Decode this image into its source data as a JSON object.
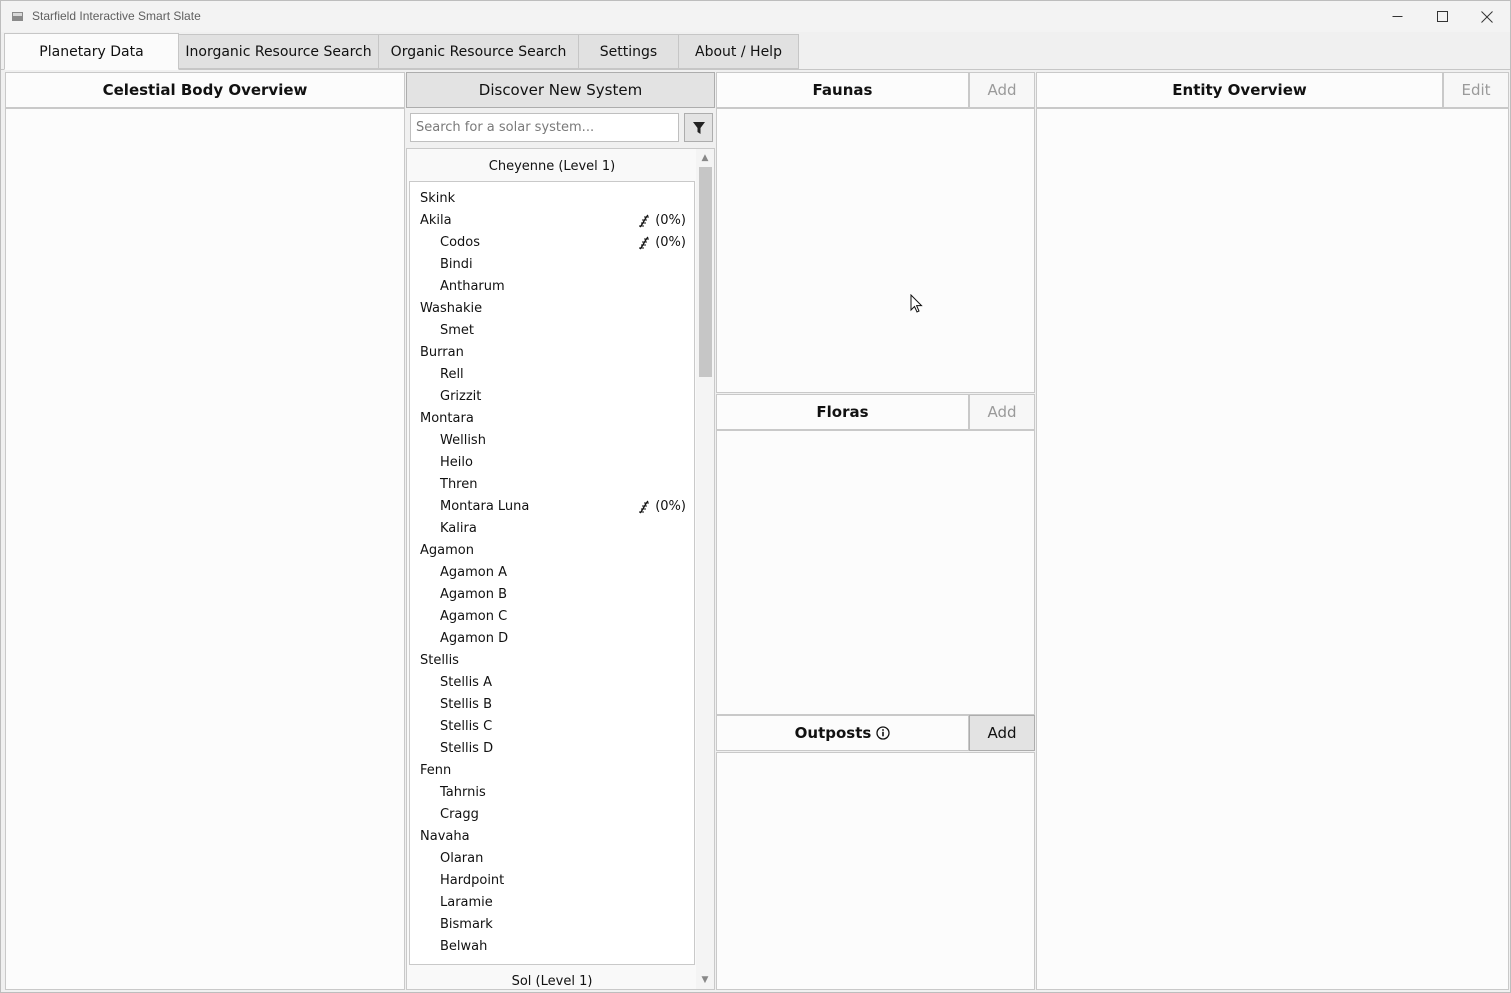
{
  "window": {
    "title": "Starfield Interactive Smart Slate"
  },
  "tabs": [
    {
      "label": "Planetary Data",
      "active": true
    },
    {
      "label": "Inorganic Resource Search"
    },
    {
      "label": "Organic Resource Search"
    },
    {
      "label": "Settings"
    },
    {
      "label": "About / Help"
    }
  ],
  "celestial": {
    "header": "Celestial Body Overview"
  },
  "discover": {
    "button_label": "Discover New System",
    "search_placeholder": "Search for a solar system...",
    "filter_icon": "filter-icon"
  },
  "systems": [
    {
      "title": "Cheyenne (Level 1)",
      "bodies": [
        {
          "name": "Skink",
          "level": 0
        },
        {
          "name": "Akila",
          "level": 0,
          "tag": "(0%)"
        },
        {
          "name": "Codos",
          "level": 1,
          "tag": "(0%)"
        },
        {
          "name": "Bindi",
          "level": 1
        },
        {
          "name": "Antharum",
          "level": 1
        },
        {
          "name": "Washakie",
          "level": 0
        },
        {
          "name": "Smet",
          "level": 1
        },
        {
          "name": "Burran",
          "level": 0
        },
        {
          "name": "Rell",
          "level": 1
        },
        {
          "name": "Grizzit",
          "level": 1
        },
        {
          "name": "Montara",
          "level": 0
        },
        {
          "name": "Wellish",
          "level": 1
        },
        {
          "name": "Heilo",
          "level": 1
        },
        {
          "name": "Thren",
          "level": 1
        },
        {
          "name": "Montara Luna",
          "level": 1,
          "tag": "(0%)"
        },
        {
          "name": "Kalira",
          "level": 1
        },
        {
          "name": "Agamon",
          "level": 0
        },
        {
          "name": "Agamon A",
          "level": 1
        },
        {
          "name": "Agamon B",
          "level": 1
        },
        {
          "name": "Agamon C",
          "level": 1
        },
        {
          "name": "Agamon D",
          "level": 1
        },
        {
          "name": "Stellis",
          "level": 0
        },
        {
          "name": "Stellis A",
          "level": 1
        },
        {
          "name": "Stellis B",
          "level": 1
        },
        {
          "name": "Stellis C",
          "level": 1
        },
        {
          "name": "Stellis D",
          "level": 1
        },
        {
          "name": "Fenn",
          "level": 0
        },
        {
          "name": "Tahrnis",
          "level": 1
        },
        {
          "name": "Cragg",
          "level": 1
        },
        {
          "name": "Navaha",
          "level": 0
        },
        {
          "name": "Olaran",
          "level": 1
        },
        {
          "name": "Hardpoint",
          "level": 1
        },
        {
          "name": "Laramie",
          "level": 1
        },
        {
          "name": "Bismark",
          "level": 1
        },
        {
          "name": "Belwah",
          "level": 1
        }
      ]
    },
    {
      "title": "Sol (Level 1)",
      "bodies": []
    }
  ],
  "faunas": {
    "header": "Faunas",
    "add_label": "Add"
  },
  "floras": {
    "header": "Floras",
    "add_label": "Add"
  },
  "outposts": {
    "header": "Outposts",
    "info_icon": "info-icon",
    "add_label": "Add"
  },
  "entity": {
    "header": "Entity Overview",
    "edit_label": "Edit"
  },
  "colors": {
    "disabled_text": "#9a9a9a",
    "button_bg": "#e3e3e3",
    "panel_bg": "#fcfcfc"
  }
}
